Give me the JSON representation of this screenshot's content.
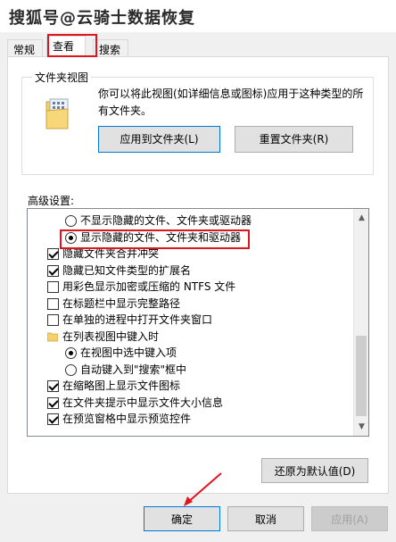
{
  "watermark": "搜狐号@云骑士数据恢复",
  "tabs": [
    {
      "label": "常规",
      "active": false
    },
    {
      "label": "查看",
      "active": true
    },
    {
      "label": "搜索",
      "active": false
    }
  ],
  "folder_views": {
    "title": "文件夹视图",
    "description": "你可以将此视图(如详细信息或图标)应用于这种类型的所有文件夹。",
    "apply_button": "应用到文件夹(L)",
    "reset_button": "重置文件夹(R)"
  },
  "advanced": {
    "label": "高级设置:",
    "items": [
      {
        "type": "radio",
        "checked": false,
        "indent": 1,
        "label": "不显示隐藏的文件、文件夹或驱动器"
      },
      {
        "type": "radio",
        "checked": true,
        "indent": 1,
        "label": "显示隐藏的文件、文件夹和驱动器"
      },
      {
        "type": "checkbox",
        "checked": true,
        "indent": 0,
        "label": "隐藏文件夹合并冲突"
      },
      {
        "type": "checkbox",
        "checked": true,
        "indent": 0,
        "label": "隐藏已知文件类型的扩展名"
      },
      {
        "type": "checkbox",
        "checked": false,
        "indent": 0,
        "label": "用彩色显示加密或压缩的 NTFS 文件"
      },
      {
        "type": "checkbox",
        "checked": false,
        "indent": 0,
        "label": "在标题栏中显示完整路径"
      },
      {
        "type": "checkbox",
        "checked": false,
        "indent": 0,
        "label": "在单独的进程中打开文件夹窗口"
      },
      {
        "type": "folder",
        "checked": false,
        "indent": 0,
        "label": "在列表视图中键入时"
      },
      {
        "type": "radio",
        "checked": true,
        "indent": 1,
        "label": "在视图中选中键入项"
      },
      {
        "type": "radio",
        "checked": false,
        "indent": 1,
        "label": "自动键入到\"搜索\"框中"
      },
      {
        "type": "checkbox",
        "checked": true,
        "indent": 0,
        "label": "在缩略图上显示文件图标"
      },
      {
        "type": "checkbox",
        "checked": true,
        "indent": 0,
        "label": "在文件夹提示中显示文件大小信息"
      },
      {
        "type": "checkbox",
        "checked": true,
        "indent": 0,
        "label": "在预览窗格中显示预览控件"
      }
    ],
    "restore_button": "还原为默认值(D)"
  },
  "footer": {
    "ok": "确定",
    "cancel": "取消",
    "apply": "应用(A)"
  },
  "colors": {
    "highlight": "#e0141e",
    "accent": "#0078d7"
  }
}
